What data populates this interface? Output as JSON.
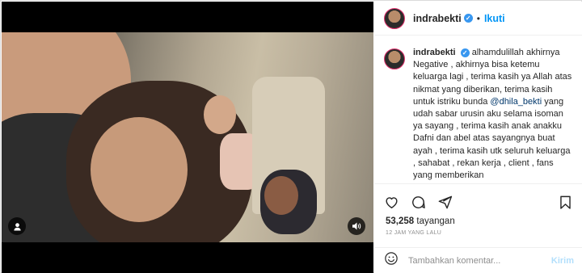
{
  "post": {
    "username": "indrabekti",
    "verified_mark": "✓",
    "separator": "•",
    "follow_label": "Ikuti"
  },
  "caption": {
    "username": "indrabekti",
    "text_before_mention": "alhamdulillah akhirnya Negative , akhirnya bisa ketemu keluarga lagi , terima kasih ya Allah atas nikmat yang diberikan, terima kasih untuk istriku bunda",
    "mention": "@dhila_bekti",
    "text_after_mention": "yang udah sabar urusin aku selama isoman ya sayang , terima kasih anak anakku Dafni dan abel atas sayangnya buat ayah , terima kasih utk seluruh keluarga , sahabat , rekan kerja , client , fans yang memberikan"
  },
  "stats": {
    "views_count": "53,258",
    "views_label": "tayangan",
    "timestamp": "12 JAM YANG LALU"
  },
  "comment": {
    "placeholder": "Tambahkan komentar...",
    "post_label": "Kirim"
  },
  "icons": {
    "like": "heart-icon",
    "comment": "comment-icon",
    "share": "share-icon",
    "save": "bookmark-icon",
    "emoji": "emoji-icon",
    "video_user": "user-icon",
    "video_audio": "speaker-icon"
  },
  "colors": {
    "link_blue": "#0095f6",
    "verified_blue": "#3897f0",
    "mention_blue": "#00376b",
    "muted": "#8e8e8e",
    "post_btn_disabled": "#b2dffc"
  }
}
